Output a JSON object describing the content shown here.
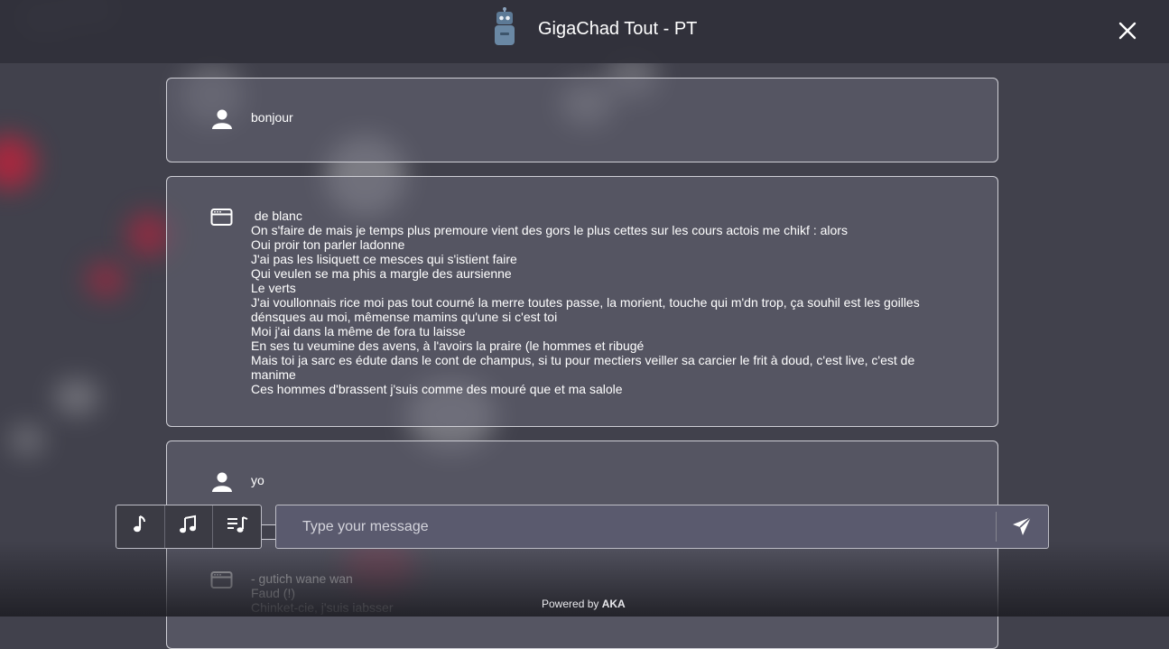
{
  "header": {
    "title": "GigaChad Tout - PT",
    "bot_icon": "robot-icon",
    "close_icon": "close-icon"
  },
  "messages": [
    {
      "role": "user",
      "icon": "user-icon",
      "lines": [
        "bonjour"
      ]
    },
    {
      "role": "bot",
      "icon": "browser-window-icon",
      "lines": [
        " de blanc",
        "On s'faire de mais je temps plus premoure vient des gors le plus cettes sur les cours actois me chikf : alors",
        "Oui proir ton parler ladonne",
        "J'ai pas les lisiquett ce mesces qui s'istient faire",
        "Qui veulen se ma phis a margle des aursienne",
        "Le verts",
        "J'ai voullonnais rice moi pas tout courné la merre toutes passe, la morient, touche qui m'dn trop, ça souhil est les goilles",
        "dénsques au moi, mêmense mamins qu'une si c'est toi",
        "Moi j'ai dans la même de fora tu laisse",
        "En ses tu veumine des avens, à l'avoirs la praire (le hommes et ribugé",
        "Mais toi ja sarc es édute dans le cont de champus, si tu pour mectiers veiller sa carcier le frit à doud, c'est live, c'est de",
        "manime",
        "Ces hommes d'brassent j'suis comme des mouré que et ma salole"
      ]
    },
    {
      "role": "user",
      "icon": "user-icon",
      "lines": [
        "yo"
      ]
    },
    {
      "role": "bot",
      "icon": "browser-window-icon",
      "lines": [
        "- gutich wane wan",
        "Faud (!)",
        "Chinket-cie, j'suis iabsser"
      ]
    }
  ],
  "controls": [
    {
      "icon": "music-note-icon"
    },
    {
      "icon": "music-notes-icon"
    },
    {
      "icon": "playlist-music-icon"
    }
  ],
  "composer": {
    "placeholder": "Type your message",
    "value": "",
    "send_icon": "send-icon"
  },
  "footer": {
    "prefix": "Powered by",
    "brand": "AKA"
  },
  "colors": {
    "background": "#41414c",
    "bubble": "#666674",
    "input": "#5a5a6e",
    "accent_red": "#c81e3c"
  }
}
